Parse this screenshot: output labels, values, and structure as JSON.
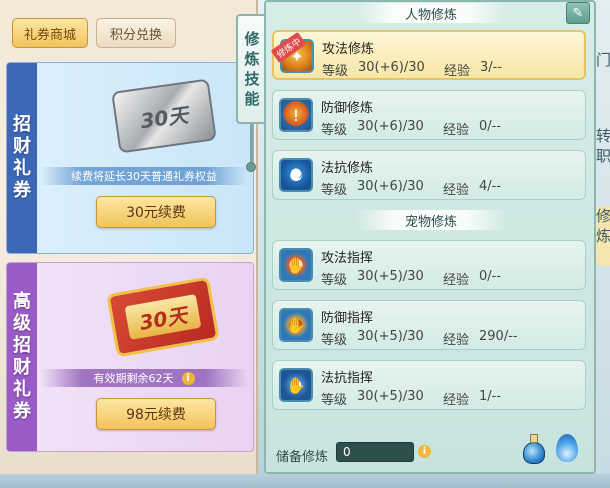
{
  "shop": {
    "tabs": [
      {
        "label": "礼券商城"
      },
      {
        "label": "积分兑换"
      }
    ],
    "cards": [
      {
        "vertical_label": [
          "招",
          "财",
          "礼",
          "券"
        ],
        "ticket_text": "30天",
        "note": "续费将延长30天普通礼券权益",
        "button": "30元续费"
      },
      {
        "vertical_label": [
          "高",
          "级",
          "招",
          "财",
          "礼",
          "券"
        ],
        "ticket_text": "30天",
        "note": "有效期剩余62天",
        "button": "98元续费"
      }
    ]
  },
  "side_tab": {
    "chars": [
      "修",
      "炼",
      "技",
      "能"
    ]
  },
  "panel": {
    "person_title": "人物修炼",
    "pet_title": "宠物修炼",
    "level_label": "等级",
    "exp_label": "经验",
    "person_rows": [
      {
        "name": "攻法修炼",
        "level": "30(+6)/30",
        "exp": "3/--",
        "badge": "修炼中",
        "icon": "attack-icon"
      },
      {
        "name": "防御修炼",
        "level": "30(+6)/30",
        "exp": "0/--",
        "icon": "defense-icon"
      },
      {
        "name": "法抗修炼",
        "level": "30(+6)/30",
        "exp": "4/--",
        "icon": "resist-icon"
      }
    ],
    "pet_rows": [
      {
        "name": "攻法指挥",
        "level": "30(+5)/30",
        "exp": "0/--",
        "icon": "pet-attack-icon"
      },
      {
        "name": "防御指挥",
        "level": "30(+5)/30",
        "exp": "290/--",
        "icon": "pet-defense-icon"
      },
      {
        "name": "法抗指挥",
        "level": "30(+5)/30",
        "exp": "1/--",
        "icon": "pet-resist-icon"
      }
    ],
    "reserve_label": "储备修炼",
    "reserve_value": "0"
  },
  "right_edge": {
    "tab1": [
      "门"
    ],
    "tab2": [
      "转",
      "职"
    ],
    "tab3": [
      "修",
      "炼"
    ]
  },
  "colors": {
    "accent_gold": "#f2c35b",
    "panel_bg": "#c8e3dd",
    "selected_row": "#f6e6a6"
  }
}
